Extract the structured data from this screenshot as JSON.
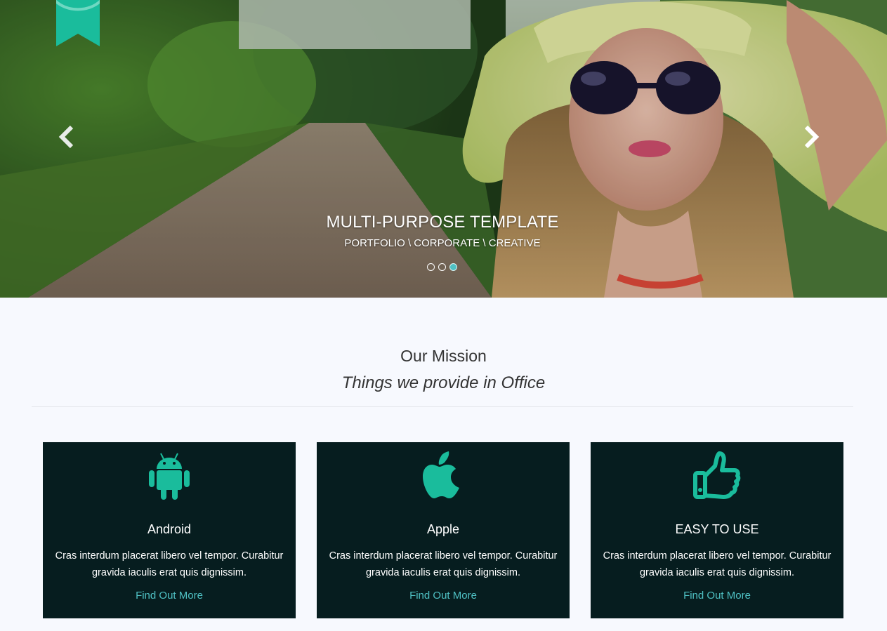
{
  "hero": {
    "title": "MULTI-PURPOSE TEMPLATE",
    "subtitle": "PORTFOLIO \\ CORPORATE \\ CREATIVE",
    "slide_count": 3,
    "active_slide": 3
  },
  "mission": {
    "title": "Our Mission",
    "subtitle": "Things we provide in Office"
  },
  "cards": [
    {
      "icon": "android-icon",
      "title": "Android",
      "text": "Cras interdum placerat libero vel tempor. Curabitur gravida iaculis erat quis dignissim.",
      "link": "Find Out More"
    },
    {
      "icon": "apple-icon",
      "title": "Apple",
      "text": "Cras interdum placerat libero vel tempor. Curabitur gravida iaculis erat quis dignissim.",
      "link": "Find Out More"
    },
    {
      "icon": "thumbs-up-icon",
      "title": "EASY TO USE",
      "text": "Cras interdum placerat libero vel tempor. Curabitur gravida iaculis erat quis dignissim.",
      "link": "Find Out More"
    }
  ],
  "colors": {
    "accent": "#1abc9c",
    "link": "#4fc1c4",
    "card_bg": "#061d1f",
    "page_bg": "#f7f9fe"
  }
}
